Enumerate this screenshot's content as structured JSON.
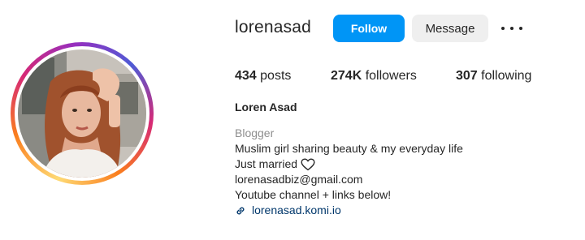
{
  "profile": {
    "username": "lorenasad",
    "full_name": "Loren Asad",
    "avatar_alt": "Profile photo of a woman with long auburn hair"
  },
  "actions": {
    "follow_label": "Follow",
    "message_label": "Message",
    "more_icon": "more-horizontal-icon"
  },
  "stats": {
    "posts_count": "434",
    "posts_label": "posts",
    "followers_count": "274K",
    "followers_label": "followers",
    "following_count": "307",
    "following_label": "following"
  },
  "bio": {
    "category": "Blogger",
    "lines": [
      "Muslim girl sharing beauty & my everyday life",
      "Just married",
      "lorenasadbiz@gmail.com",
      "Youtube channel + links below!"
    ],
    "link": "lorenasad.komi.io"
  },
  "colors": {
    "follow_button": "#0095f6",
    "message_button": "#efefef",
    "link": "#00376b",
    "category": "#8e8e8e"
  }
}
